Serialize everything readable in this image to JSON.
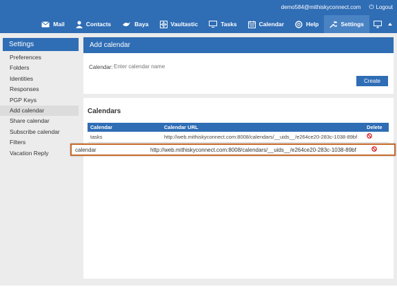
{
  "header": {
    "user_email": "demo584@mithiskyconnect.com",
    "logout_label": "Logout",
    "nav": [
      {
        "label": "Mail",
        "icon": "mail-icon"
      },
      {
        "label": "Contacts",
        "icon": "contacts-icon"
      },
      {
        "label": "Baya",
        "icon": "baya-icon"
      },
      {
        "label": "Vaultastic",
        "icon": "vaultastic-icon"
      },
      {
        "label": "Tasks",
        "icon": "tasks-icon"
      },
      {
        "label": "Calendar",
        "icon": "calendar-icon"
      },
      {
        "label": "Help",
        "icon": "help-icon"
      },
      {
        "label": "Settings",
        "icon": "wrench-icon",
        "active": true
      }
    ]
  },
  "sidebar": {
    "title": "Settings",
    "items": [
      {
        "label": "Preferences"
      },
      {
        "label": "Folders"
      },
      {
        "label": "Identities"
      },
      {
        "label": "Responses"
      },
      {
        "label": "PGP Keys"
      },
      {
        "label": "Add calendar",
        "selected": true
      },
      {
        "label": "Share calendar"
      },
      {
        "label": "Subscribe calendar"
      },
      {
        "label": "Filters"
      },
      {
        "label": "Vacation Reply"
      }
    ]
  },
  "add_calendar": {
    "title": "Add calendar",
    "field_label": "Calendar:",
    "placeholder": "Enter calendar name",
    "create_label": "Create"
  },
  "calendars": {
    "title": "Calendars",
    "columns": [
      "Calendar",
      "Calendar URL",
      "Delete"
    ],
    "rows": [
      {
        "name": "tasks",
        "url": "http://web.mithiskyconnect.com:8008/calendars/__uids__/e264ce20-283c-1038-89bf"
      }
    ],
    "highlighted_row": {
      "name": "calendar",
      "url": "http://web.mithiskyconnect.com:8008/calendars/__uids__/e264ce20-283c-1038-89bf"
    }
  },
  "colors": {
    "accent": "#2f6db5",
    "highlight_border": "#c56a2a",
    "delete": "#d9232a"
  }
}
